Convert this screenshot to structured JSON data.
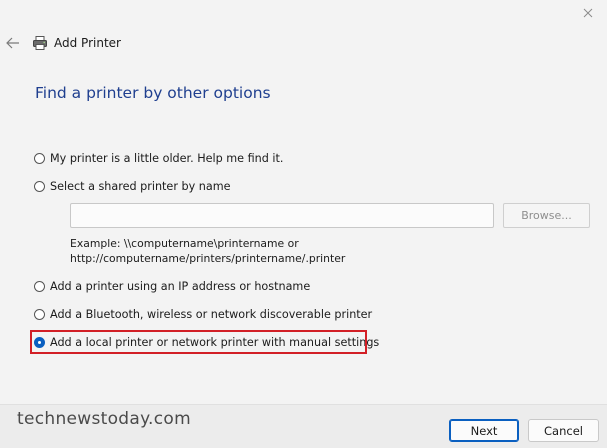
{
  "window": {
    "title": "Add Printer",
    "heading": "Find a printer by other options"
  },
  "options": [
    {
      "label": "My printer is a little older. Help me find it.",
      "selected": false
    },
    {
      "label": "Select a shared printer by name",
      "selected": false
    },
    {
      "label": "Add a printer using an IP address or hostname",
      "selected": false
    },
    {
      "label": "Add a Bluetooth, wireless or network discoverable printer",
      "selected": false
    },
    {
      "label": "Add a local printer or network printer with manual settings",
      "selected": true
    }
  ],
  "shared_printer": {
    "input_value": "",
    "browse_label": "Browse...",
    "example_line1": "Example: \\\\computername\\printername or",
    "example_line2": "http://computername/printers/printername/.printer"
  },
  "footer": {
    "watermark": "technewstoday.com",
    "next_label": "Next",
    "cancel_label": "Cancel"
  },
  "icons": {
    "close": "close-icon",
    "back": "back-arrow-icon",
    "printer": "printer-icon"
  },
  "colors": {
    "heading": "#1f3f8f",
    "accent": "#0a5fc0",
    "highlight_border": "#d21f26"
  }
}
